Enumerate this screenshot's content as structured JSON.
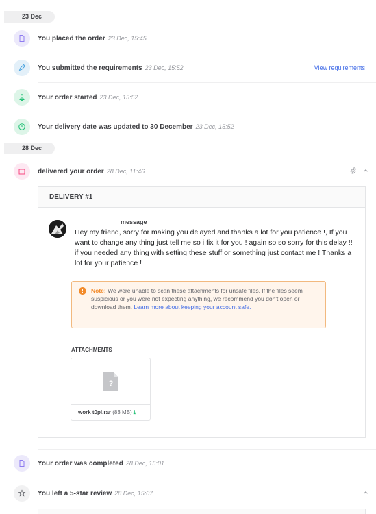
{
  "dates": {
    "first": "23 Dec",
    "second": "28 Dec"
  },
  "events": [
    {
      "text": "You placed the order",
      "time": "23 Dec, 15:45",
      "icon": "document-icon",
      "color": "#8e7cf0"
    },
    {
      "text": "You submitted the requirements",
      "time": "23 Dec, 15:52",
      "link": "View requirements",
      "icon": "pencil-icon",
      "color": "#4aa3df"
    },
    {
      "text": "Your order started",
      "time": "23 Dec, 15:52",
      "icon": "rocket-icon",
      "color": "#1dbf73"
    },
    {
      "text": "Your delivery date was updated to 30 December",
      "time": "23 Dec, 15:52",
      "icon": "clock-icon",
      "color": "#1dbf73"
    },
    {
      "text": "delivered your order",
      "time": "28 Dec, 11:46",
      "icon": "package-icon",
      "color": "#f74780"
    },
    {
      "text": "Your order was completed",
      "time": "28 Dec, 15:01",
      "icon": "document-icon",
      "color": "#8e7cf0"
    },
    {
      "text": "You left a 5-star review",
      "time": "28 Dec, 15:07",
      "icon": "star-icon",
      "color": "#62646a"
    }
  ],
  "delivery": {
    "title": "DELIVERY #1",
    "message_label": "message",
    "message": "Hey my friend, sorry for making you delayed and thanks a lot for you patience !, If you want to change any thing just tell me so i fix it for you ! again so so sorry for this delay !! if you needed any thing with setting these stuff or something just contact me ! Thanks a lot for your patience !",
    "note_label": "Note:",
    "note_text": " We were unable to scan these attachments for unsafe files. If the files seem suspicious or you were not expecting anything, we recommend you don't open or download them. ",
    "note_link": "Learn more about keeping your account safe.",
    "attachments_title": "ATTACHMENTS",
    "file_name": "work t0pl.rar",
    "file_size": "(83 MB)"
  }
}
